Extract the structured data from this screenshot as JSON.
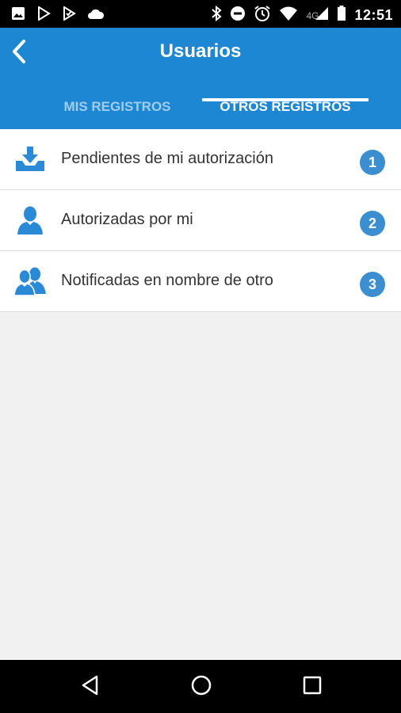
{
  "status_bar": {
    "time": "12:51",
    "network": "4G",
    "left_icons": [
      "image-icon",
      "play-store-icon",
      "play-check-icon",
      "cloud-icon"
    ],
    "right_icons": [
      "bluetooth-icon",
      "do-not-disturb-icon",
      "alarm-icon",
      "wifi-icon",
      "signal-icon",
      "battery-icon"
    ]
  },
  "header": {
    "title": "Usuarios",
    "back_icon": "chevron-left-icon",
    "background": "#1e87d3"
  },
  "tabs": [
    {
      "label": "MIS REGISTROS",
      "active": false
    },
    {
      "label": "OTROS REGISTROS",
      "active": true
    }
  ],
  "list": {
    "items": [
      {
        "label": "Pendientes de mi autorización",
        "badge": "1",
        "icon": "download-tray-icon"
      },
      {
        "label": "Autorizadas por mi",
        "badge": "2",
        "icon": "user-icon"
      },
      {
        "label": "Notificadas en nombre de otro",
        "badge": "3",
        "icon": "users-icon"
      }
    ]
  },
  "colors": {
    "accent": "#1e87d3",
    "badge": "#3b8fd1",
    "icon": "#2b8ad6"
  },
  "nav_bar": {
    "buttons": [
      "back-triangle-icon",
      "home-circle-icon",
      "recents-square-icon"
    ]
  }
}
